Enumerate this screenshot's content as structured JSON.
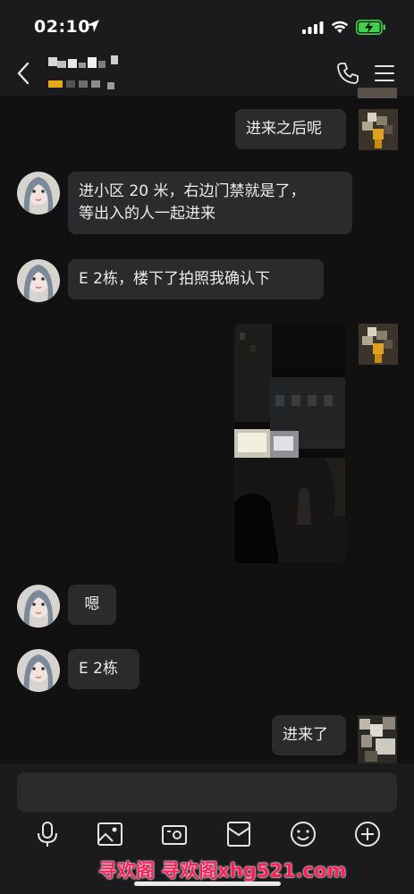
{
  "status_bar": {
    "time": "02:10",
    "battery_color": "#3ed04a"
  },
  "header": {
    "contact_name_obscured": true
  },
  "messages": [
    {
      "side": "right",
      "text": "进来之后呢"
    },
    {
      "side": "left",
      "text": "进小区 20 米，右边门禁就是了，\n等出入的人一起进来"
    },
    {
      "side": "left",
      "text": "E 2栋，楼下了拍照我确认下"
    },
    {
      "side": "right",
      "type": "photo"
    },
    {
      "side": "left",
      "text": "嗯"
    },
    {
      "side": "left",
      "text": "E 2栋"
    },
    {
      "side": "right",
      "text": "进来了"
    }
  ],
  "toolbar": {
    "icons": [
      "microphone-icon",
      "image-icon",
      "camera-icon",
      "red-packet-icon",
      "emoji-icon",
      "plus-icon"
    ]
  },
  "watermark": "寻欢阁 寻欢阁xhg521.com",
  "colors": {
    "bubble": "#2b2b2d",
    "background": "#111111",
    "bar": "#1b1b1d"
  }
}
